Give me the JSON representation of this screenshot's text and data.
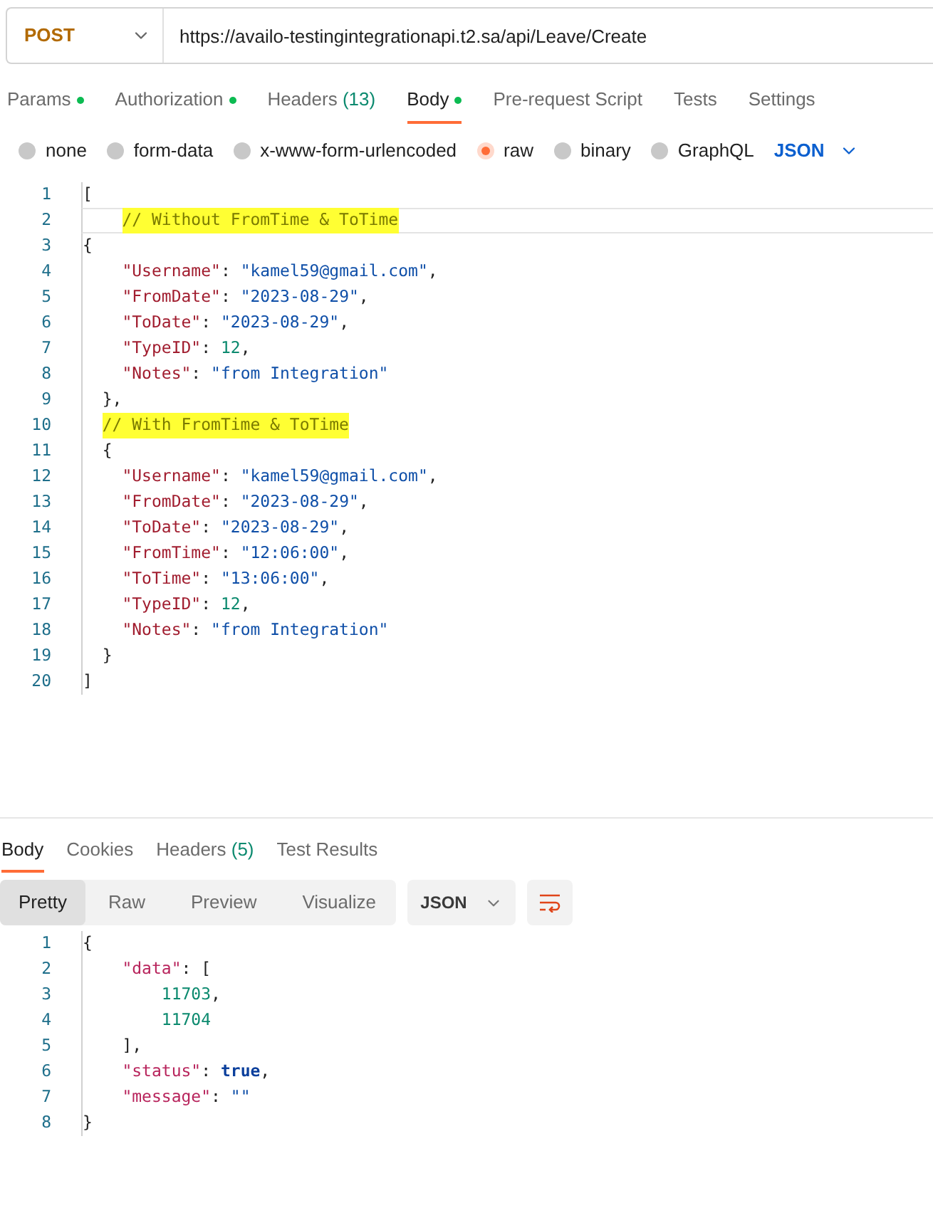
{
  "request": {
    "method": "POST",
    "url": "https://availo-testingintegrationapi.t2.sa/api/Leave/Create"
  },
  "tabs": [
    {
      "label": "Params",
      "dot": true,
      "selected": false
    },
    {
      "label": "Authorization",
      "dot": true,
      "selected": false
    },
    {
      "label": "Headers",
      "count": "(13)",
      "dot": false,
      "selected": false
    },
    {
      "label": "Body",
      "dot": true,
      "selected": true
    },
    {
      "label": "Pre-request Script",
      "dot": false,
      "selected": false
    },
    {
      "label": "Tests",
      "dot": false,
      "selected": false
    },
    {
      "label": "Settings",
      "dot": false,
      "selected": false
    }
  ],
  "body_types": [
    {
      "label": "none",
      "selected": false
    },
    {
      "label": "form-data",
      "selected": false
    },
    {
      "label": "x-www-form-urlencoded",
      "selected": false
    },
    {
      "label": "raw",
      "selected": true
    },
    {
      "label": "binary",
      "selected": false
    },
    {
      "label": "GraphQL",
      "selected": false
    }
  ],
  "format": "JSON",
  "request_body": [
    {
      "n": "1",
      "text": "["
    },
    {
      "n": "2",
      "text": "    // Without FromTime & ToTime",
      "current": true
    },
    {
      "n": "3",
      "text": "{"
    },
    {
      "n": "4",
      "text": "    \"Username\": \"kamel59@gmail.com\","
    },
    {
      "n": "5",
      "text": "    \"FromDate\": \"2023-08-29\","
    },
    {
      "n": "6",
      "text": "    \"ToDate\": \"2023-08-29\","
    },
    {
      "n": "7",
      "text": "    \"TypeID\": 12,"
    },
    {
      "n": "8",
      "text": "    \"Notes\": \"from Integration\""
    },
    {
      "n": "9",
      "text": "  },"
    },
    {
      "n": "10",
      "text": "  // With FromTime & ToTime"
    },
    {
      "n": "11",
      "text": "  {"
    },
    {
      "n": "12",
      "text": "    \"Username\": \"kamel59@gmail.com\","
    },
    {
      "n": "13",
      "text": "    \"FromDate\": \"2023-08-29\","
    },
    {
      "n": "14",
      "text": "    \"ToDate\": \"2023-08-29\","
    },
    {
      "n": "15",
      "text": "    \"FromTime\": \"12:06:00\","
    },
    {
      "n": "16",
      "text": "    \"ToTime\": \"13:06:00\","
    },
    {
      "n": "17",
      "text": "    \"TypeID\": 12,"
    },
    {
      "n": "18",
      "text": "    \"Notes\": \"from Integration\""
    },
    {
      "n": "19",
      "text": "  }"
    },
    {
      "n": "20",
      "text": "]"
    }
  ],
  "response_tabs": [
    {
      "label": "Body",
      "selected": true
    },
    {
      "label": "Cookies",
      "selected": false
    },
    {
      "label": "Headers",
      "count": "(5)",
      "selected": false
    },
    {
      "label": "Test Results",
      "selected": false
    }
  ],
  "view_modes": [
    {
      "label": "Pretty",
      "selected": true
    },
    {
      "label": "Raw",
      "selected": false
    },
    {
      "label": "Preview",
      "selected": false
    },
    {
      "label": "Visualize",
      "selected": false
    }
  ],
  "response_format": "JSON",
  "response_body": [
    {
      "n": "1",
      "text": "{"
    },
    {
      "n": "2",
      "text": "    \"data\": ["
    },
    {
      "n": "3",
      "text": "        11703,"
    },
    {
      "n": "4",
      "text": "        11704"
    },
    {
      "n": "5",
      "text": "    ],"
    },
    {
      "n": "6",
      "text": "    \"status\": true,"
    },
    {
      "n": "7",
      "text": "    \"message\": \"\""
    },
    {
      "n": "8",
      "text": "}"
    }
  ]
}
